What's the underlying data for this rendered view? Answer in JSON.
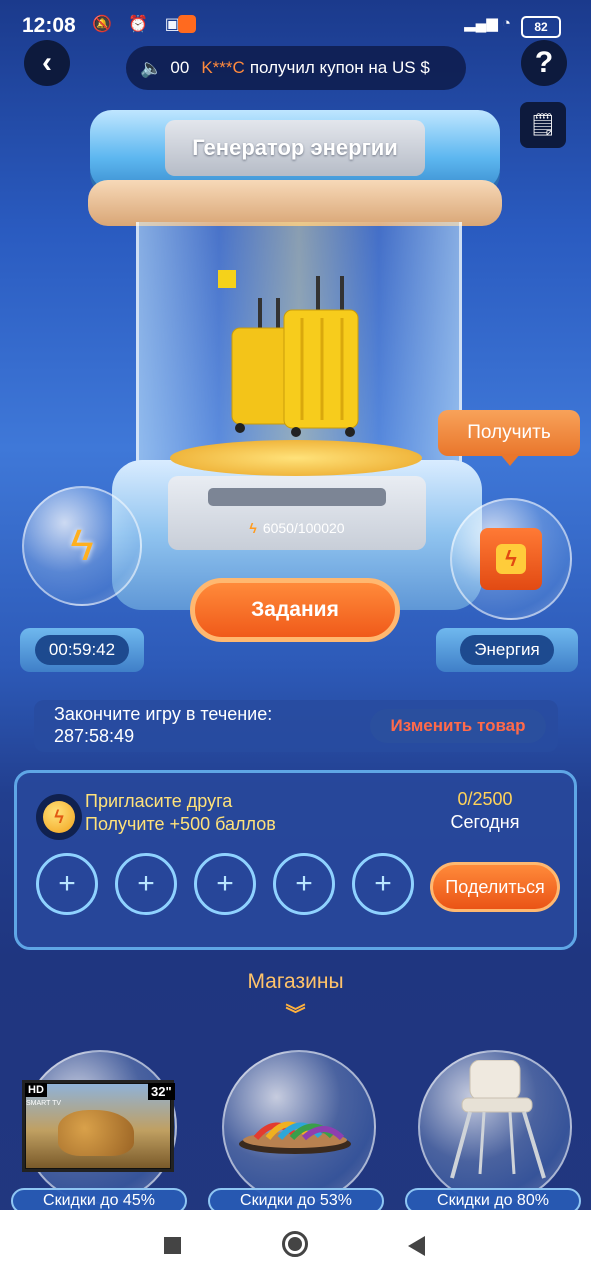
{
  "status": {
    "time": "12:08",
    "battery": "82"
  },
  "topbar": {
    "back_icon": "back-arrow-icon",
    "help_label": "?",
    "ticker": {
      "prefix": "00",
      "user": "K***C",
      "message": "получил купон на US $"
    }
  },
  "generator": {
    "title": "Генератор энергии",
    "energy": "6050/100020",
    "tasks_label": "Задания",
    "receive_label": "Получить"
  },
  "left_pod": {
    "timer": "00:59:42"
  },
  "right_pod": {
    "label": "Энергия"
  },
  "deadline": {
    "label": "Закончите игру в течение:",
    "value": "287:58:49",
    "change_label": "Изменить товар"
  },
  "invite": {
    "title": "Пригласите друга",
    "subtitle": "Получите +500 баллов",
    "count": "0/2500",
    "period": "Сегодня",
    "slot_symbol": "+",
    "share_label": "Поделиться"
  },
  "shops": {
    "title": "Магазины",
    "chevron": "»",
    "items": [
      {
        "label": "Скидки до 45%",
        "tv_hd": "HD",
        "tv_smart": "SMART TV",
        "tv_size": "32\""
      },
      {
        "label": "Скидки до 53%"
      },
      {
        "label": "Скидки до 80%"
      }
    ]
  },
  "colors": {
    "accent_orange": "#ef5b1a",
    "panel_blue": "#284b9b",
    "gold": "#ffd35a"
  }
}
